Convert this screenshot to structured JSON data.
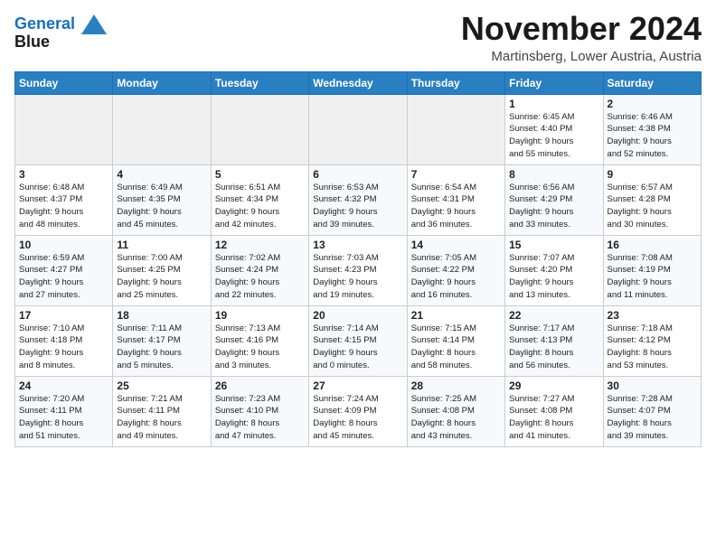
{
  "header": {
    "logo_line1": "General",
    "logo_line2": "Blue",
    "month": "November 2024",
    "location": "Martinsberg, Lower Austria, Austria"
  },
  "days_of_week": [
    "Sunday",
    "Monday",
    "Tuesday",
    "Wednesday",
    "Thursday",
    "Friday",
    "Saturday"
  ],
  "weeks": [
    {
      "cells": [
        {
          "day": "",
          "info": ""
        },
        {
          "day": "",
          "info": ""
        },
        {
          "day": "",
          "info": ""
        },
        {
          "day": "",
          "info": ""
        },
        {
          "day": "",
          "info": ""
        },
        {
          "day": "1",
          "info": "Sunrise: 6:45 AM\nSunset: 4:40 PM\nDaylight: 9 hours\nand 55 minutes."
        },
        {
          "day": "2",
          "info": "Sunrise: 6:46 AM\nSunset: 4:38 PM\nDaylight: 9 hours\nand 52 minutes."
        }
      ]
    },
    {
      "cells": [
        {
          "day": "3",
          "info": "Sunrise: 6:48 AM\nSunset: 4:37 PM\nDaylight: 9 hours\nand 48 minutes."
        },
        {
          "day": "4",
          "info": "Sunrise: 6:49 AM\nSunset: 4:35 PM\nDaylight: 9 hours\nand 45 minutes."
        },
        {
          "day": "5",
          "info": "Sunrise: 6:51 AM\nSunset: 4:34 PM\nDaylight: 9 hours\nand 42 minutes."
        },
        {
          "day": "6",
          "info": "Sunrise: 6:53 AM\nSunset: 4:32 PM\nDaylight: 9 hours\nand 39 minutes."
        },
        {
          "day": "7",
          "info": "Sunrise: 6:54 AM\nSunset: 4:31 PM\nDaylight: 9 hours\nand 36 minutes."
        },
        {
          "day": "8",
          "info": "Sunrise: 6:56 AM\nSunset: 4:29 PM\nDaylight: 9 hours\nand 33 minutes."
        },
        {
          "day": "9",
          "info": "Sunrise: 6:57 AM\nSunset: 4:28 PM\nDaylight: 9 hours\nand 30 minutes."
        }
      ]
    },
    {
      "cells": [
        {
          "day": "10",
          "info": "Sunrise: 6:59 AM\nSunset: 4:27 PM\nDaylight: 9 hours\nand 27 minutes."
        },
        {
          "day": "11",
          "info": "Sunrise: 7:00 AM\nSunset: 4:25 PM\nDaylight: 9 hours\nand 25 minutes."
        },
        {
          "day": "12",
          "info": "Sunrise: 7:02 AM\nSunset: 4:24 PM\nDaylight: 9 hours\nand 22 minutes."
        },
        {
          "day": "13",
          "info": "Sunrise: 7:03 AM\nSunset: 4:23 PM\nDaylight: 9 hours\nand 19 minutes."
        },
        {
          "day": "14",
          "info": "Sunrise: 7:05 AM\nSunset: 4:22 PM\nDaylight: 9 hours\nand 16 minutes."
        },
        {
          "day": "15",
          "info": "Sunrise: 7:07 AM\nSunset: 4:20 PM\nDaylight: 9 hours\nand 13 minutes."
        },
        {
          "day": "16",
          "info": "Sunrise: 7:08 AM\nSunset: 4:19 PM\nDaylight: 9 hours\nand 11 minutes."
        }
      ]
    },
    {
      "cells": [
        {
          "day": "17",
          "info": "Sunrise: 7:10 AM\nSunset: 4:18 PM\nDaylight: 9 hours\nand 8 minutes."
        },
        {
          "day": "18",
          "info": "Sunrise: 7:11 AM\nSunset: 4:17 PM\nDaylight: 9 hours\nand 5 minutes."
        },
        {
          "day": "19",
          "info": "Sunrise: 7:13 AM\nSunset: 4:16 PM\nDaylight: 9 hours\nand 3 minutes."
        },
        {
          "day": "20",
          "info": "Sunrise: 7:14 AM\nSunset: 4:15 PM\nDaylight: 9 hours\nand 0 minutes."
        },
        {
          "day": "21",
          "info": "Sunrise: 7:15 AM\nSunset: 4:14 PM\nDaylight: 8 hours\nand 58 minutes."
        },
        {
          "day": "22",
          "info": "Sunrise: 7:17 AM\nSunset: 4:13 PM\nDaylight: 8 hours\nand 56 minutes."
        },
        {
          "day": "23",
          "info": "Sunrise: 7:18 AM\nSunset: 4:12 PM\nDaylight: 8 hours\nand 53 minutes."
        }
      ]
    },
    {
      "cells": [
        {
          "day": "24",
          "info": "Sunrise: 7:20 AM\nSunset: 4:11 PM\nDaylight: 8 hours\nand 51 minutes."
        },
        {
          "day": "25",
          "info": "Sunrise: 7:21 AM\nSunset: 4:11 PM\nDaylight: 8 hours\nand 49 minutes."
        },
        {
          "day": "26",
          "info": "Sunrise: 7:23 AM\nSunset: 4:10 PM\nDaylight: 8 hours\nand 47 minutes."
        },
        {
          "day": "27",
          "info": "Sunrise: 7:24 AM\nSunset: 4:09 PM\nDaylight: 8 hours\nand 45 minutes."
        },
        {
          "day": "28",
          "info": "Sunrise: 7:25 AM\nSunset: 4:08 PM\nDaylight: 8 hours\nand 43 minutes."
        },
        {
          "day": "29",
          "info": "Sunrise: 7:27 AM\nSunset: 4:08 PM\nDaylight: 8 hours\nand 41 minutes."
        },
        {
          "day": "30",
          "info": "Sunrise: 7:28 AM\nSunset: 4:07 PM\nDaylight: 8 hours\nand 39 minutes."
        }
      ]
    }
  ]
}
